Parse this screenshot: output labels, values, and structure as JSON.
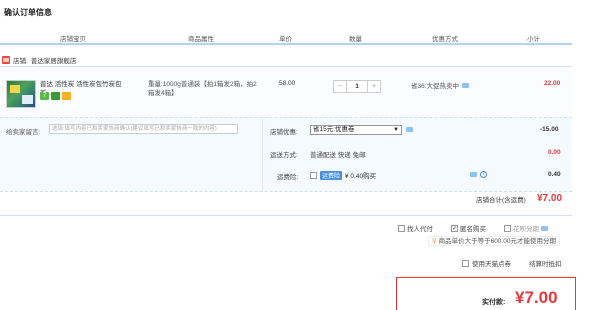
{
  "page_title": "确认订单信息",
  "columns": [
    "店铺宝贝",
    "商品属性",
    "单价",
    "数量",
    "优惠方式",
    "小计"
  ],
  "shop": {
    "label": "店铺:",
    "name": "普达家居旗舰店"
  },
  "item": {
    "name": "普达 活性炭 活性炭包竹炭包新...",
    "badges": [
      "7",
      "",
      ""
    ],
    "attributes": "重量:1000g普通装【拍1箱发2箱，拍2箱发4箱】",
    "unit_price": "58.00",
    "quantity": "1",
    "qty_minus": "−",
    "qty_plus": "+",
    "promo": "省36:大促热卖中",
    "subtotal": "22.00"
  },
  "message": {
    "label": "给卖家留言:",
    "placeholder": "选填:填写内容已和卖家协商确认(建议填写已和卖家协商一致的内容)"
  },
  "options": {
    "shop_discount_label": "店铺优惠:",
    "shop_discount_value": "省15元:优惠卷",
    "shop_discount_amount": "-15.00",
    "shipping_label": "运送方式:",
    "shipping_value": "普通配送 快递 免邮",
    "shipping_amount": "0.00",
    "insurance_label": "运费险:",
    "insurance_tag": "运费险",
    "insurance_value": "¥ 0.40购买",
    "insurance_amount": "0.40",
    "help_glyph": "?"
  },
  "shop_total": {
    "label": "店铺合计(含运费)",
    "amount": "¥7.00"
  },
  "flags": {
    "proxy_pay": "找人代付",
    "anonymous": "匿名购买",
    "huabei": "花呗分期",
    "install_note_pre": "商品单价大于等于",
    "install_note_amt": "600.00",
    "install_note_post": "元才能使用分期"
  },
  "coins": {
    "tmall_coin": "使用天猫点券",
    "points": "结算时抵扣"
  },
  "payment": {
    "label": "实付款:",
    "amount": "¥7.00"
  }
}
